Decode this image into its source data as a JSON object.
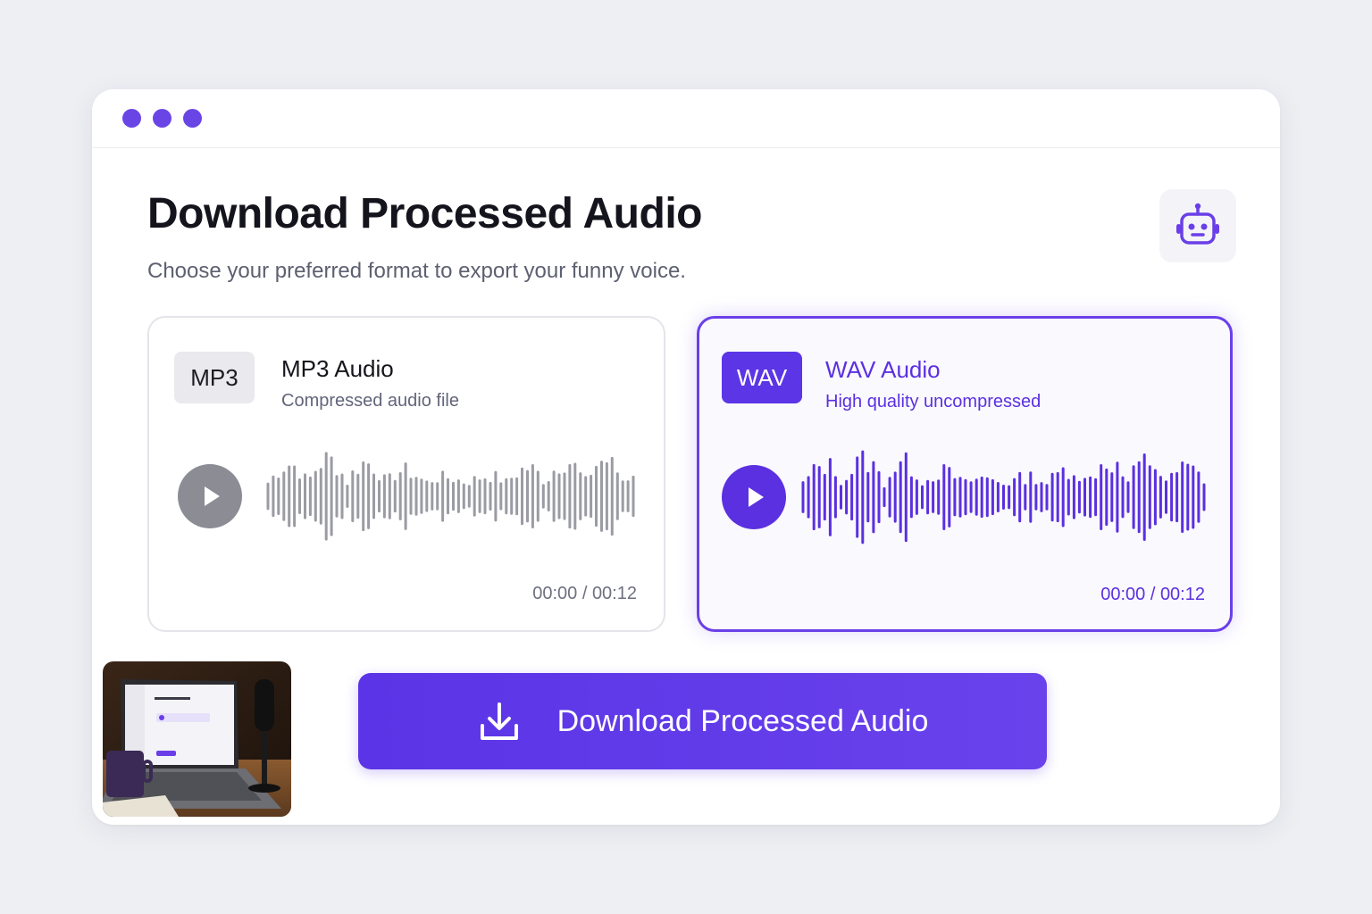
{
  "window": {
    "dots": [
      "dot-1",
      "dot-2",
      "dot-3"
    ],
    "accent": "#6a45e6"
  },
  "header": {
    "title": "Download Processed Audio",
    "subtitle": "Choose your preferred format to export your funny voice.",
    "bot_icon": "robot-icon"
  },
  "formats": {
    "mp3": {
      "badge": "MP3",
      "title": "MP3 Audio",
      "description": "Compressed audio file",
      "time": "00:00 / 00:12",
      "selected": false,
      "color": "#9a9ba3"
    },
    "wav": {
      "badge": "WAV",
      "title": "WAV Audio",
      "description": "High quality uncompressed",
      "time": "00:00 / 00:12",
      "selected": true,
      "color": "#5b30e0"
    }
  },
  "thumbnail": {
    "icon": "laptop-podcast-photo"
  },
  "download_button": {
    "label": "Download Processed Audio",
    "icon": "download-icon"
  }
}
